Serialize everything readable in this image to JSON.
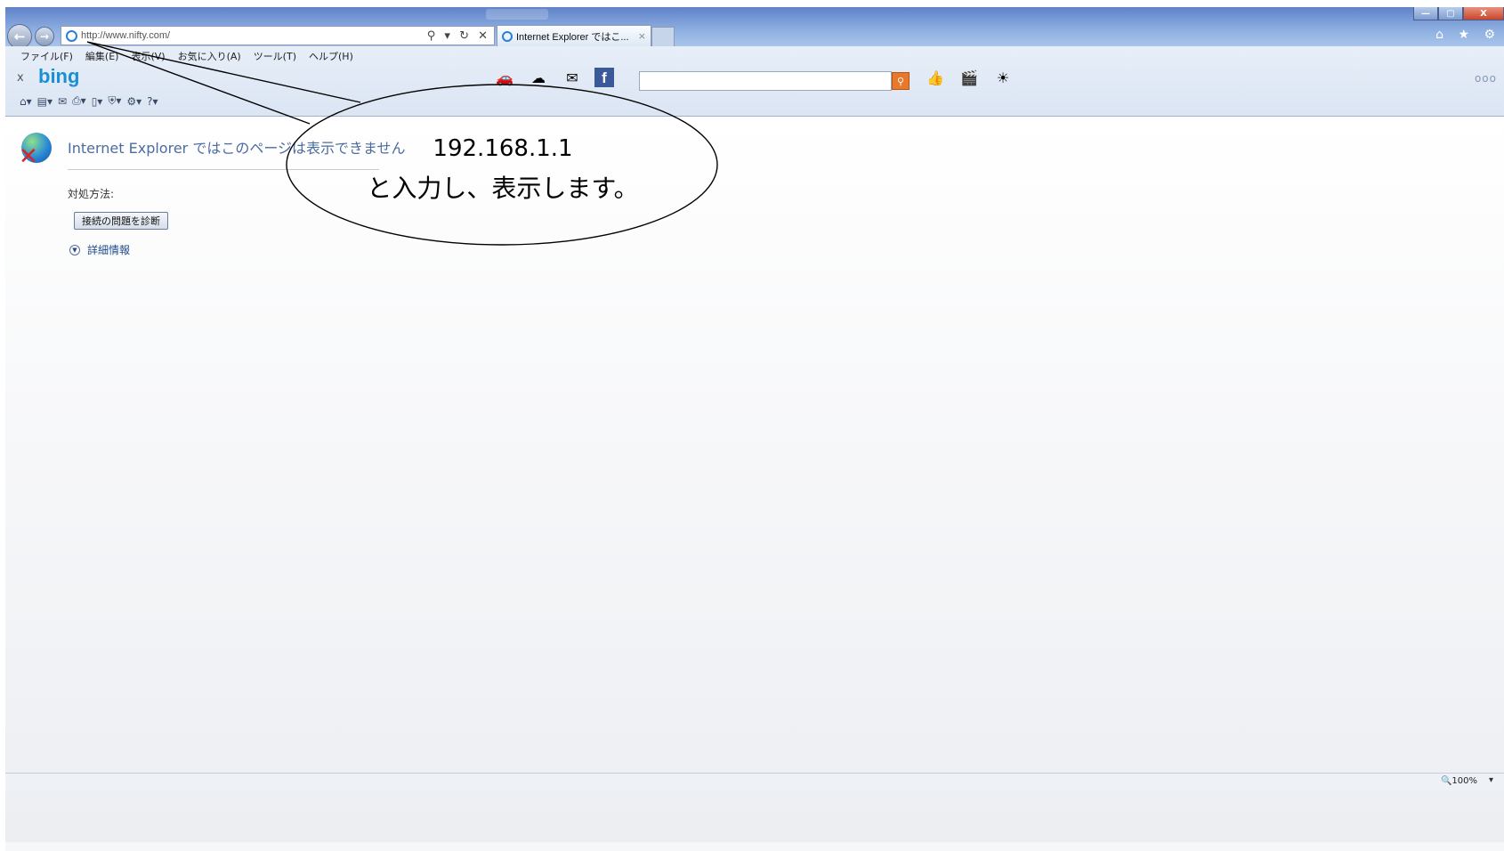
{
  "window": {
    "minimize_label": "—",
    "maximize_label": "▢",
    "close_label": "X"
  },
  "navigation": {
    "back_icon": "←",
    "forward_icon": "→",
    "address_url": "http://www.nifty.com/",
    "address_controls": "⚲ ▾ ↻ ✕"
  },
  "tab": {
    "title": "Internet Explorer ではこ...",
    "close": "×"
  },
  "right_icons": "⌂ ★ ⚙",
  "menu": [
    "ファイル(F)",
    "編集(E)",
    "表示(V)",
    "お気に入り(A)",
    "ツール(T)",
    "ヘルプ(H)"
  ],
  "bing_bar": {
    "close": "x",
    "logo": "bing",
    "icons": [
      "🚗",
      "☁",
      "✉",
      "f"
    ],
    "search_value": "",
    "right_icons": [
      "👍",
      "🎬",
      "☀"
    ],
    "more": "ooo"
  },
  "command_bar": [
    "⌂▾",
    "▤▾",
    "✉",
    "⎙▾",
    "▯▾",
    "⛨▾",
    "⚙▾",
    "?▾"
  ],
  "error_page": {
    "title": "Internet Explorer ではこのページは表示できません",
    "howto_label": "対処方法:",
    "diagnose_button": "接続の問題を診断",
    "more_info": "詳細情報"
  },
  "status": {
    "zoom": "🔍100%",
    "zoom_dropdown": "▾"
  },
  "callout": {
    "line1": "192.168.1.1",
    "line2": "と入力し、表示します。"
  }
}
